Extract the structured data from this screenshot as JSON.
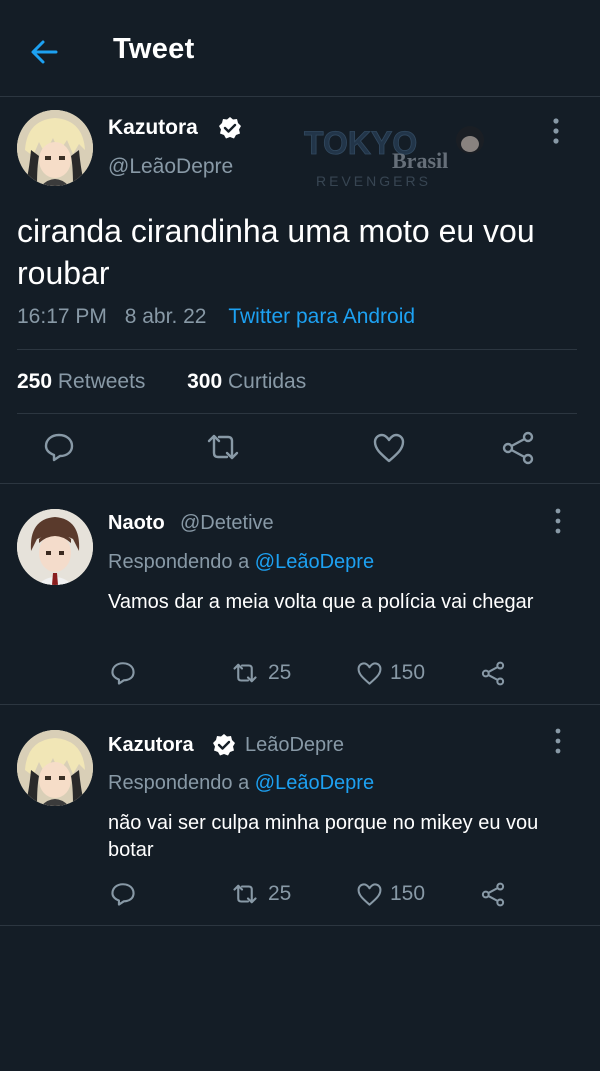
{
  "header": {
    "title": "Tweet",
    "back_icon": "arrow-left-icon",
    "accent": "#1da1f2"
  },
  "watermark": {
    "line1": "TOKYO",
    "line2": "Brasil",
    "line3": "REVENGERS"
  },
  "main_tweet": {
    "author_name": "Kazutora",
    "author_handle": "@LeãoDepre",
    "verified": true,
    "text": "ciranda cirandinha uma moto eu vou roubar",
    "time": "16:17 PM",
    "date": "8 abr. 22",
    "source": "Twitter para Android",
    "retweets_count": "250",
    "retweets_label": "Retweets",
    "likes_count": "300",
    "likes_label": "Curtidas",
    "actions": [
      "reply-icon",
      "retweet-icon",
      "like-icon",
      "share-icon"
    ]
  },
  "replies": [
    {
      "author_name": "Naoto",
      "author_handle": "@Detetive",
      "verified": false,
      "replying_prefix": "Respondendo a",
      "replying_to": "@LeãoDepre",
      "text": "Vamos dar a meia volta que a polícia vai chegar",
      "retweets": "25",
      "likes": "150"
    },
    {
      "author_name": "Kazutora",
      "author_handle": "LeãoDepre",
      "verified": true,
      "replying_prefix": "Respondendo a",
      "replying_to": "@LeãoDepre",
      "text": "não vai ser culpa minha porque no mikey eu vou botar",
      "retweets": "25",
      "likes": "150"
    }
  ],
  "colors": {
    "background": "#141d26",
    "divider": "#2c3640",
    "muted": "#8899a6",
    "link": "#1da1f2",
    "verified": "#ffffff"
  }
}
